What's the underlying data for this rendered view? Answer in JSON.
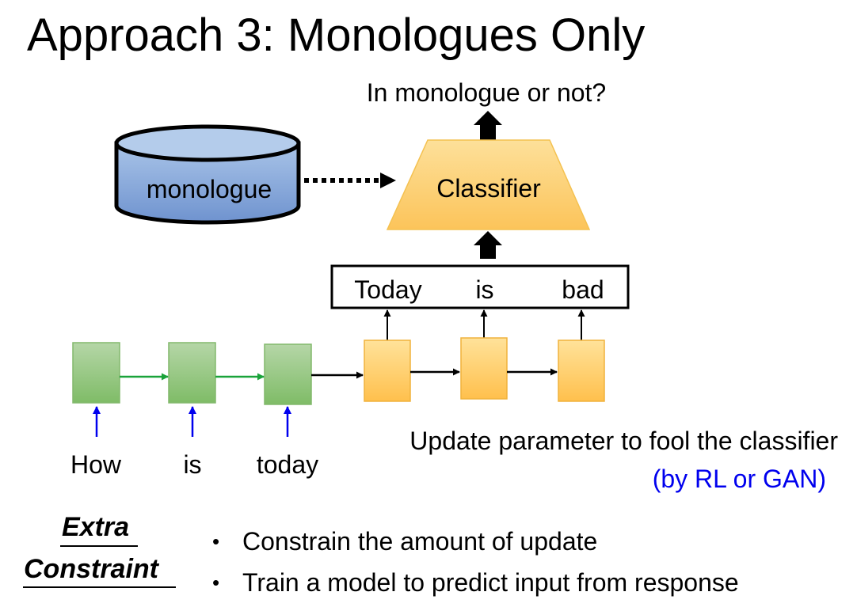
{
  "title": "Approach 3: Monologues Only",
  "output_question": "In monologue or not?",
  "database_label": "monologue",
  "classifier_label": "Classifier",
  "output_tokens": [
    "Today",
    "is",
    "bad"
  ],
  "input_tokens": [
    "How",
    "is",
    "today"
  ],
  "update_note": "Update parameter to fool the classifier",
  "method_note": "(by RL or GAN)",
  "extra_constraint": {
    "line1": "Extra",
    "line2": "Constraint"
  },
  "bullets": [
    "Constrain the amount of update",
    "Train a model to predict input from response"
  ],
  "colors": {
    "encoder_fill": "#93c47d",
    "decoder_fill": "#ffd966",
    "classifier_fill": "#fdd27a",
    "db_fill": "#8eaadb",
    "encoder_arrow": "#1aa33a",
    "input_arrow": "#0000ee",
    "method_text": "#0000ee"
  }
}
